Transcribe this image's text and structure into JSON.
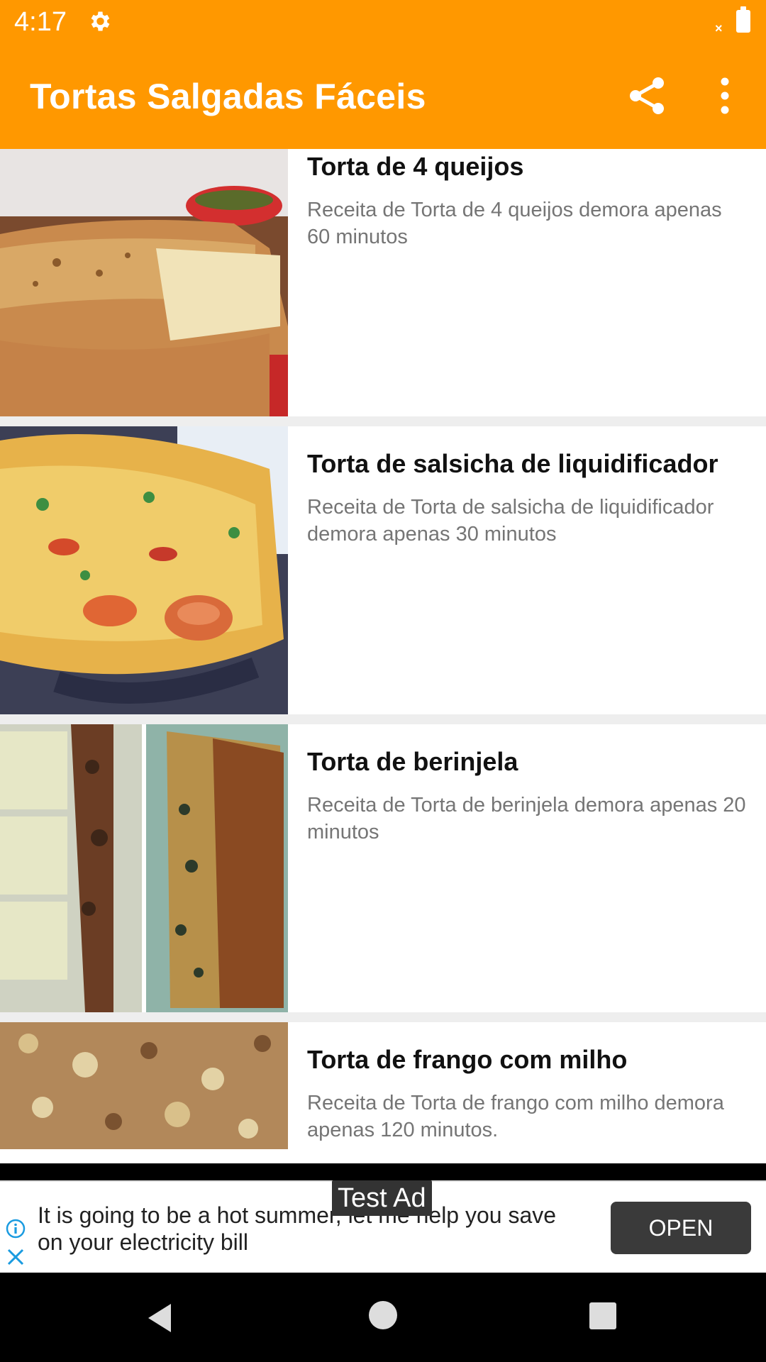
{
  "status": {
    "time": "4:17"
  },
  "appbar": {
    "title": "Tortas Salgadas Fáceis"
  },
  "recipes": [
    {
      "title": "Torta de 4 queijos",
      "description": "Receita de Torta de 4 queijos demora apenas 60 minutos"
    },
    {
      "title": "Torta de salsicha de liquidificador",
      "description": "Receita de Torta de salsicha de liquidificador demora apenas 30 minutos"
    },
    {
      "title": "Torta de berinjela",
      "description": "Receita de Torta de berinjela demora apenas 20 minutos"
    },
    {
      "title": "Torta de frango com milho",
      "description": "Receita de Torta de frango com milho demora apenas 120 minutos."
    }
  ],
  "ad": {
    "label": "Test Ad",
    "text": "It is going to be a hot summer, let me help you save on your electricity bill",
    "button": "OPEN"
  },
  "colors": {
    "primary": "#FF9800",
    "divider": "#EEEEEE"
  }
}
